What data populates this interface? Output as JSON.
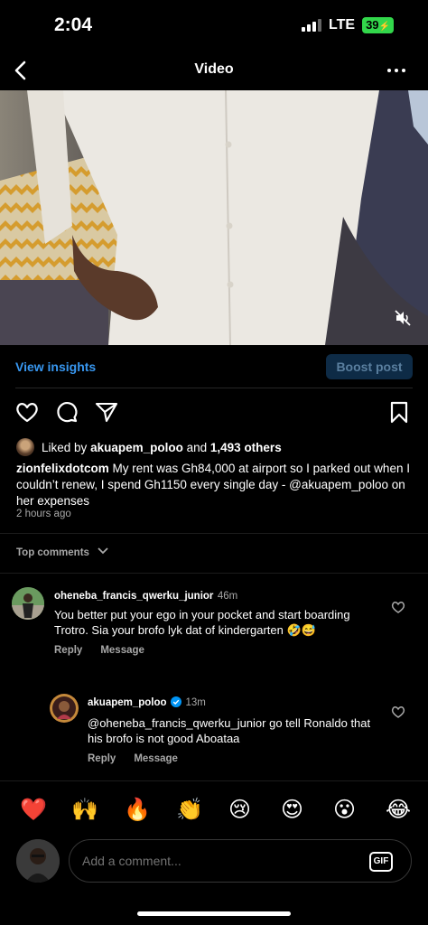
{
  "status_bar": {
    "time": "2:04",
    "network": "LTE",
    "battery": "39"
  },
  "nav": {
    "title": "Video",
    "back_icon": "chevron-left-icon",
    "more_icon": "more-horizontal-icon"
  },
  "video": {
    "mute_icon": "speaker-muted-icon"
  },
  "insights": {
    "view_insights_label": "View insights",
    "boost_post_label": "Boost post"
  },
  "actions": {
    "like_icon": "heart-icon",
    "comment_icon": "comment-icon",
    "share_icon": "send-icon",
    "save_icon": "bookmark-icon"
  },
  "likes": {
    "prefix": "Liked by",
    "user": "akuapem_poloo",
    "conjunction": "and",
    "others": "1,493 others"
  },
  "caption": {
    "user": "zionfelixdotcom",
    "text": "My rent was Gh84,000 at airport so I parked out when I couldn’t renew, I spend Gh1150 every single day - @akuapem_poloo on her expenses",
    "time_ago": "2 hours ago"
  },
  "top_comments_label": "Top comments",
  "comments": [
    {
      "user": "oheneba_francis_qwerku_junior",
      "time": "46m",
      "text": "You better put your ego in your pocket and start boarding Trotro. Sia your brofo lyk dat of kindergarten 🤣😅",
      "reply_label": "Reply",
      "message_label": "Message"
    },
    {
      "user": "akuapem_poloo",
      "verified": true,
      "time": "13m",
      "text": "@oheneba_francis_qwerku_junior go tell Ronaldo that his brofo is not good Aboataa",
      "reply_label": "Reply",
      "message_label": "Message"
    }
  ],
  "emoji_bar": [
    "❤️",
    "🙌",
    "🔥",
    "👏",
    "😢",
    "😍",
    "😮",
    "😂"
  ],
  "comment_input": {
    "placeholder": "Add a comment...",
    "gif_label": "GIF"
  },
  "colors": {
    "accent_blue": "#3897f0",
    "background": "#000000",
    "battery_green": "#32d74b",
    "verified_blue": "#0095f6"
  }
}
